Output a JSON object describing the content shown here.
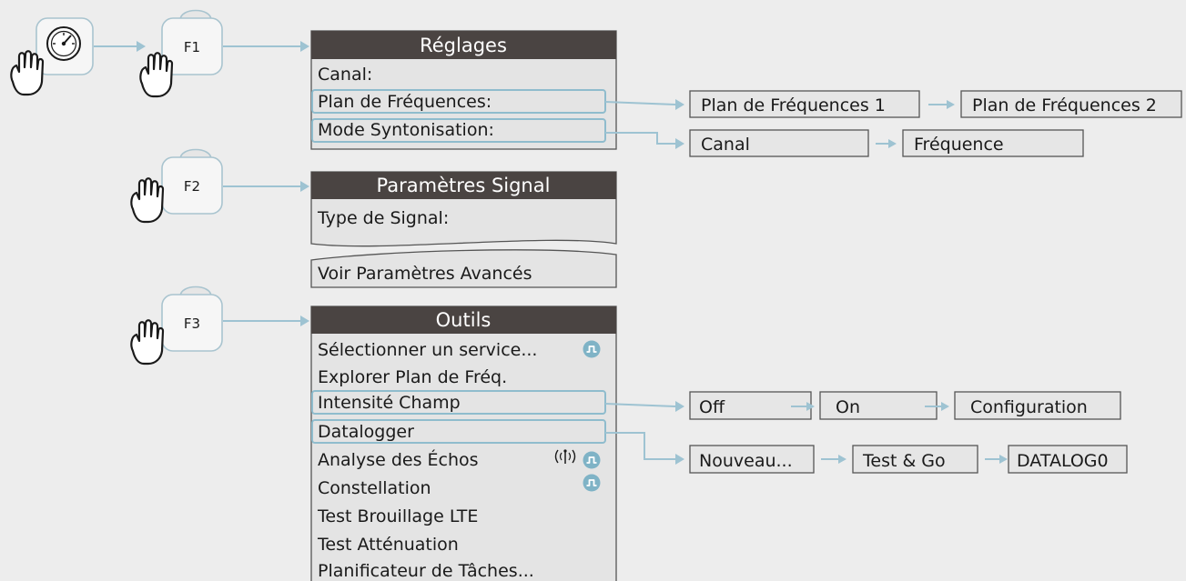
{
  "colors": {
    "background": "#ededed",
    "menu_titlebar": "#4a4442",
    "menu_panel": "#e4e4e4",
    "connector": "#9ec3d2",
    "highlight": "#8fbccd",
    "service_icon": "#7fb3c6"
  },
  "icons": {
    "hand": "pointing-hand-icon",
    "gauge": "gauge-icon",
    "service": "waveform-pulse-icon",
    "antenna": "antenna-icon"
  },
  "keys": {
    "f1": "F1",
    "f2": "F2",
    "f3": "F3"
  },
  "menus": {
    "reglages": {
      "title": "Réglages",
      "items": [
        "Canal:",
        "Plan de Fréquences:",
        "Mode Syntonisation:"
      ]
    },
    "signal": {
      "title": "Paramètres Signal",
      "items": [
        "Type de Signal:",
        "Voir Paramètres Avancés"
      ]
    },
    "outils": {
      "title": "Outils",
      "items": [
        "Sélectionner un service...",
        "Explorer Plan de Fréq.",
        "Intensité Champ",
        "Datalogger",
        "Analyse des Échos",
        "Constellation",
        "Test Brouillage LTE",
        "Test Atténuation",
        "Planificateur de Tâches..."
      ]
    }
  },
  "options": {
    "plan_frequences": [
      "Plan de Fréquences 1",
      "Plan de Fréquences 2"
    ],
    "mode_syntonisation": [
      "Canal",
      "Fréquence"
    ],
    "intensite_champ": [
      "Off",
      "On",
      "Configuration"
    ],
    "datalogger": [
      "Nouveau...",
      "Test & Go",
      "DATALOG0"
    ]
  }
}
